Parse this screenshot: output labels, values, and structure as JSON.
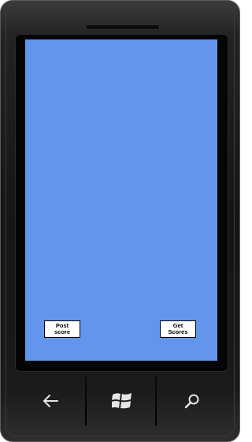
{
  "colors": {
    "screen_background": "#6495ED",
    "phone_body": "#1A1A1A",
    "hw_icon": "#E6E6E6"
  },
  "app": {
    "buttons": {
      "post_score_label": "Post\nscore",
      "get_scores_label": "Get\nScores"
    }
  },
  "hardware_buttons": {
    "back_icon": "arrow-left",
    "start_icon": "windows-flag",
    "search_icon": "magnifier"
  }
}
